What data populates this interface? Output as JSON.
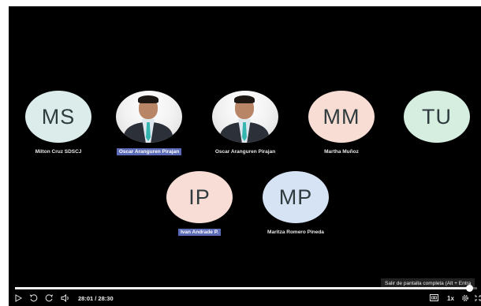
{
  "participants_row1": [
    {
      "initials": "MS",
      "name": "Milton Cruz SDSCJ",
      "color": "#dbeceb",
      "highlight": false,
      "photo": false
    },
    {
      "initials": "",
      "name": "Oscar Aranguren Pirajan",
      "color": "",
      "highlight": true,
      "photo": true
    },
    {
      "initials": "",
      "name": "Oscar Aranguren Pirajan",
      "color": "",
      "highlight": false,
      "photo": true
    },
    {
      "initials": "MM",
      "name": "Martha Muñoz",
      "color": "#f7ddd3",
      "highlight": false,
      "photo": false
    },
    {
      "initials": "TU",
      "name": "",
      "color": "#d5eedf",
      "highlight": false,
      "photo": false
    }
  ],
  "participants_row2": [
    {
      "initials": "IP",
      "name": "Ivan Andrade P.",
      "color": "#f8ddd6",
      "highlight": true,
      "photo": false
    },
    {
      "initials": "MP",
      "name": "Maritza Romero Pineda",
      "color": "#d5e3f4",
      "highlight": false,
      "photo": false
    }
  ],
  "player": {
    "time": "28:01 / 28:30",
    "progress_fraction": 0.983,
    "speed": "1x",
    "tooltip": "Salir de pantalla completa (Alt + Entra"
  },
  "icons": {
    "play": "play-icon",
    "skip_back": "skip-back-icon",
    "skip_forward": "skip-forward-icon",
    "volume": "volume-icon",
    "captions": "captions-icon",
    "settings": "settings-icon",
    "fullscreen": "exit-fullscreen-icon"
  }
}
